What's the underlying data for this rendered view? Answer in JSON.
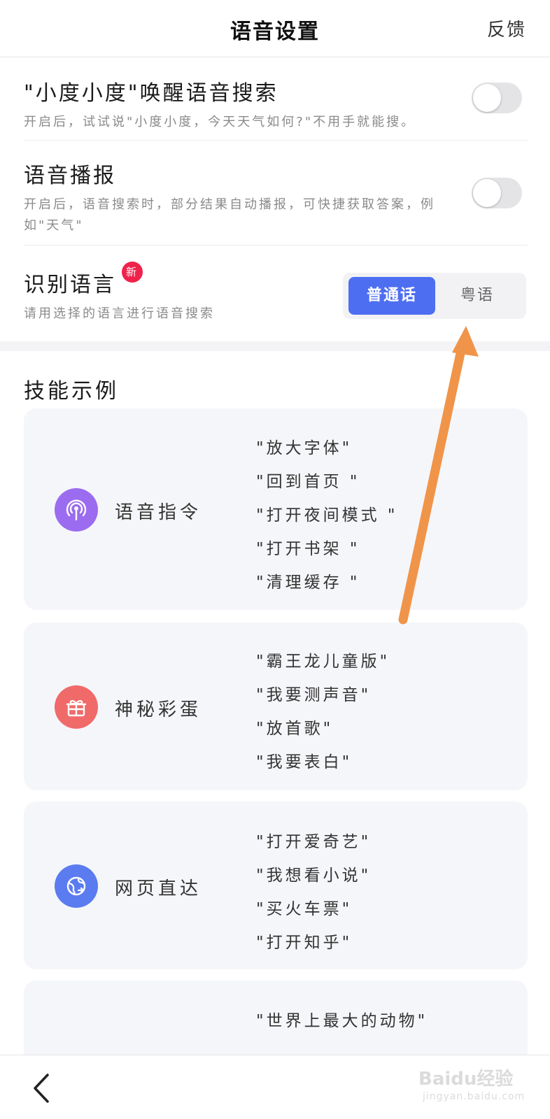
{
  "header": {
    "title": "语音设置",
    "feedback": "反馈"
  },
  "settings": {
    "wake": {
      "title": "\"小度小度\"唤醒语音搜索",
      "desc": "开启后，试试说\"小度小度，今天天气如何?\"不用手就能搜。",
      "enabled": false
    },
    "broadcast": {
      "title": "语音播报",
      "desc_line1": "开启后，语音搜索时，部分结果自动播报，可快捷获取答案，例",
      "desc_line2": "如\"天气\"",
      "enabled": false
    },
    "language": {
      "title": "识别语言",
      "badge": "新",
      "desc": "请用选择的语言进行语音搜索",
      "options": [
        "普通话",
        "粤语"
      ],
      "selected": "普通话"
    }
  },
  "skills": {
    "title": "技能示例",
    "cards": [
      {
        "name": "语音指令",
        "icon": "broadcast-icon",
        "color": "#9b6cf0",
        "examples": [
          "\"放大字体\"",
          "\"回到首页 \"",
          "\"打开夜间模式 \"",
          "\"打开书架 \"",
          "\"清理缓存 \""
        ]
      },
      {
        "name": "神秘彩蛋",
        "icon": "gift-icon",
        "color": "#f06a6a",
        "examples": [
          "\"霸王龙儿童版\"",
          "\"我要测声音\"",
          "\"放首歌\"",
          "\"我要表白\""
        ]
      },
      {
        "name": "网页直达",
        "icon": "globe-icon",
        "color": "#5b7cf0",
        "examples": [
          "\"打开爱奇艺\"",
          "\"我想看小说\"",
          "\"买火车票\"",
          "\"打开知乎\""
        ]
      },
      {
        "name": "",
        "icon": "",
        "color": "",
        "examples": [
          "\"世界上最大的动物\""
        ]
      }
    ]
  },
  "watermark": {
    "main": "Baidu经验",
    "sub": "jingyan.baidu.com"
  },
  "colors": {
    "accent": "#4e6ef2",
    "arrow": "#f0944a",
    "badge": "#f0224b"
  }
}
